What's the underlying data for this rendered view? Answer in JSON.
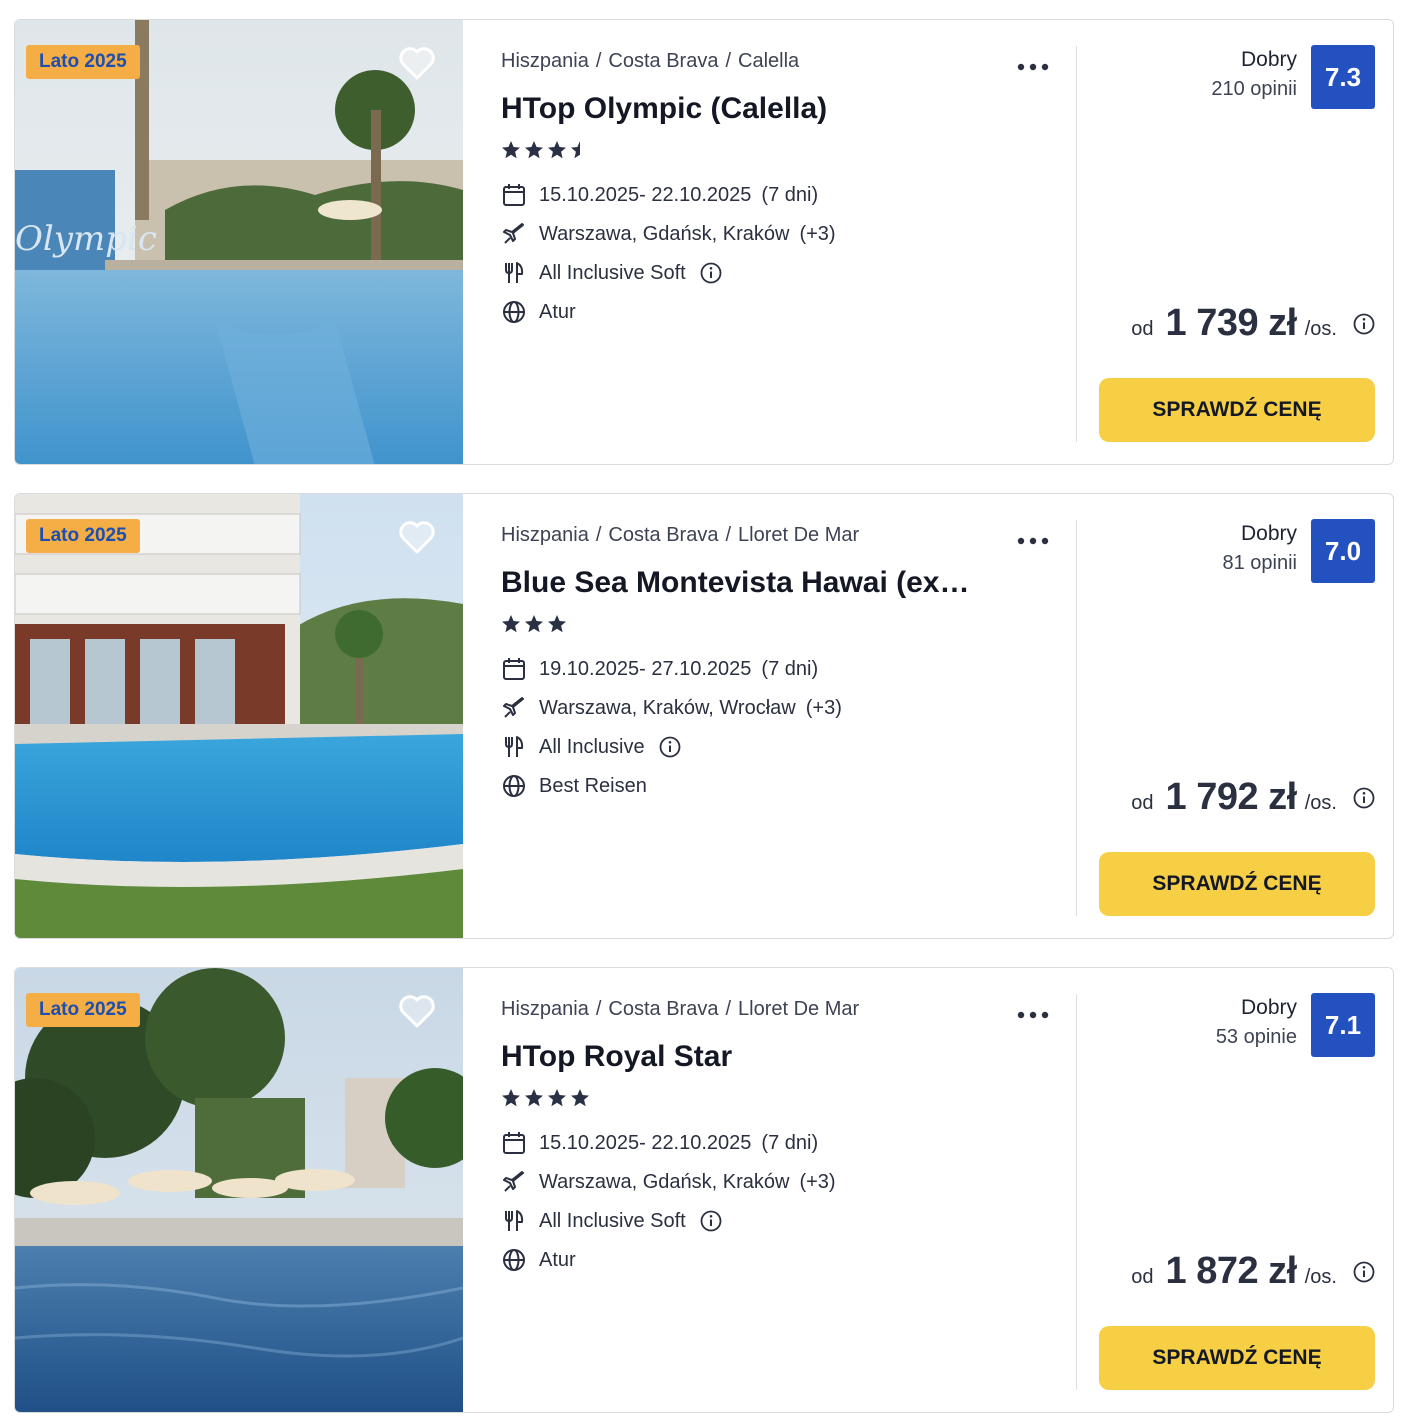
{
  "offers": [
    {
      "badge": "Lato 2025",
      "breadcrumb": [
        "Hiszpania",
        "Costa Brava",
        "Calella"
      ],
      "name": "HTop Olympic (Calella)",
      "stars": 3.5,
      "dates": "15.10.2025- 22.10.2025",
      "duration": "(7 dni)",
      "departures": "Warszawa, Gdańsk, Kraków",
      "departures_more": "(+3)",
      "board": "All Inclusive Soft",
      "operator": "Atur",
      "rating_label": "Dobry",
      "reviews": "210 opinii",
      "score": "7.3",
      "price_from": "od",
      "price": "1 739 zł",
      "price_unit": "/os.",
      "cta": "SPRAWDŹ CENĘ"
    },
    {
      "badge": "Lato 2025",
      "breadcrumb": [
        "Hiszpania",
        "Costa Brava",
        "Lloret De Mar"
      ],
      "name": "Blue Sea Montevista Hawai (ex…",
      "stars": 3,
      "dates": "19.10.2025- 27.10.2025",
      "duration": "(7 dni)",
      "departures": "Warszawa, Kraków, Wrocław",
      "departures_more": "(+3)",
      "board": "All Inclusive",
      "operator": "Best Reisen",
      "rating_label": "Dobry",
      "reviews": "81 opinii",
      "score": "7.0",
      "price_from": "od",
      "price": "1 792 zł",
      "price_unit": "/os.",
      "cta": "SPRAWDŹ CENĘ"
    },
    {
      "badge": "Lato 2025",
      "breadcrumb": [
        "Hiszpania",
        "Costa Brava",
        "Lloret De Mar"
      ],
      "name": "HTop Royal Star",
      "stars": 4,
      "dates": "15.10.2025- 22.10.2025",
      "duration": "(7 dni)",
      "departures": "Warszawa, Gdańsk, Kraków",
      "departures_more": "(+3)",
      "board": "All Inclusive Soft",
      "operator": "Atur",
      "rating_label": "Dobry",
      "reviews": "53 opinie",
      "score": "7.1",
      "price_from": "od",
      "price": "1 872 zł",
      "price_unit": "/os.",
      "cta": "SPRAWDŹ CENĘ"
    }
  ],
  "icons": {
    "favorite": "heart-icon",
    "more": "more-options-icon",
    "date": "calendar-icon",
    "departure": "plane-icon",
    "board": "cutlery-icon",
    "operator": "globe-icon",
    "info": "info-icon"
  },
  "colors": {
    "badge_bg": "#f5ad45",
    "badge_text": "#1d4fae",
    "score_bg": "#2352c0",
    "cta_bg": "#f6cf45",
    "text_dark": "#141824"
  }
}
